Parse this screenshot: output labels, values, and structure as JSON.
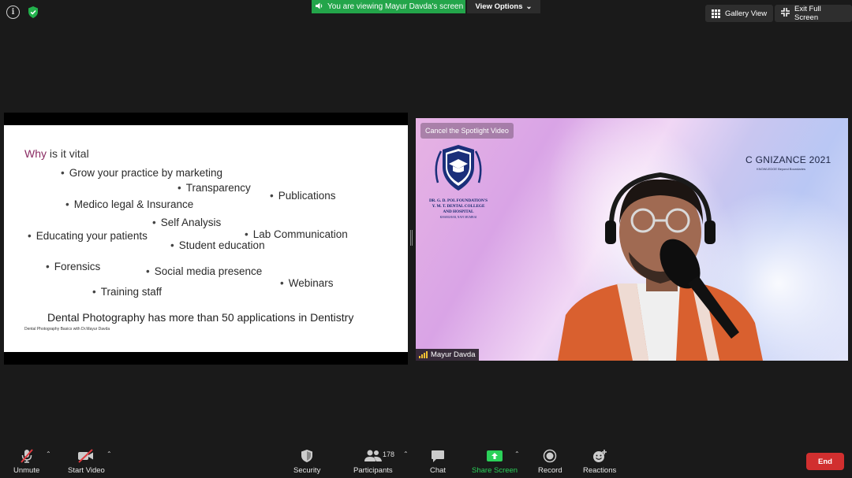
{
  "header": {
    "viewing_banner": "You are viewing Mayur Davda's screen",
    "view_options": "View Options",
    "gallery_view": "Gallery View",
    "exit_full_screen": "Exit Full Screen"
  },
  "slide": {
    "title_highlight": "Why",
    "title_rest": " is it vital",
    "bullets": [
      "Grow your practice by marketing",
      "Transparency",
      "Publications",
      "Medico legal & Insurance",
      "Self Analysis",
      "Educating your patients",
      "Lab Communication",
      "Student education",
      "Forensics",
      "Social media presence",
      "Webinars",
      "Training staff"
    ],
    "bottom_text": "Dental Photography has more than 50 applications in Dentistry",
    "footer": "Dental Photography Basics with Dr.Mayur Davda"
  },
  "video": {
    "cancel_spotlight": "Cancel the Spotlight Video",
    "participant_name": "Mayur Davda",
    "college_line1": "DR. G. D. POL FOUNDATION'S",
    "college_line2": "Y. M. T. DENTAL COLLEGE",
    "college_line3": "AND HOSPITAL",
    "college_line4": "KHARGHAR, NAVI MUMBAI",
    "event_title": "C  GNIZANCE 2021",
    "event_subtitle": "KNOWLEDGE Beyond Boundaries"
  },
  "toolbar": {
    "unmute": "Unmute",
    "start_video": "Start Video",
    "security": "Security",
    "participants": "Participants",
    "participants_count": "178",
    "chat": "Chat",
    "share_screen": "Share Screen",
    "record": "Record",
    "reactions": "Reactions",
    "end": "End"
  },
  "colors": {
    "share_green": "#23a54a",
    "end_red": "#d12f2f",
    "slide_accent": "#8a2a62"
  }
}
